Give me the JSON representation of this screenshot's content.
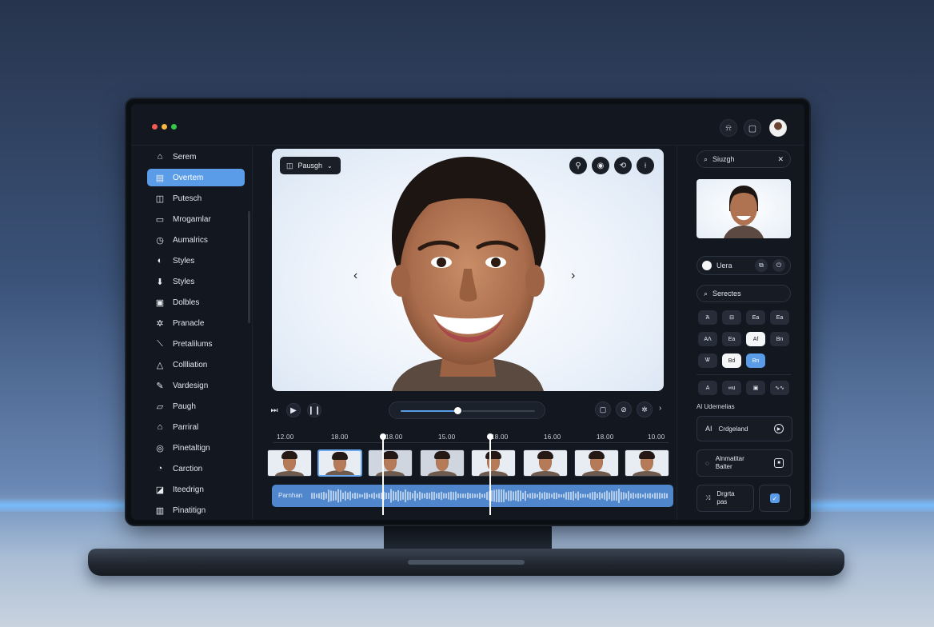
{
  "window": {
    "dots": [
      "#f25a53",
      "#f4b73f",
      "#35c84a"
    ]
  },
  "topbar": {
    "icons": [
      "bell-icon",
      "square-icon"
    ]
  },
  "sidebar": {
    "items": [
      {
        "label": "Serem",
        "icon": "⌂"
      },
      {
        "label": "Overtem",
        "icon": "▤",
        "active": true
      },
      {
        "label": "Putesch",
        "icon": "◫"
      },
      {
        "label": "Mrogamlar",
        "icon": "▭"
      },
      {
        "label": "Aumalrics",
        "icon": "◷"
      },
      {
        "label": "Styles",
        "icon": "◐"
      },
      {
        "label": "Styles",
        "icon": "⬇"
      },
      {
        "label": "Dolbles",
        "icon": "▣"
      },
      {
        "label": "Pranacle",
        "icon": "✲"
      },
      {
        "label": "Pretalilums",
        "icon": "⟍"
      },
      {
        "label": "Collliation",
        "icon": "△"
      },
      {
        "label": "Vardesign",
        "icon": "✎"
      },
      {
        "label": "Paugh",
        "icon": "▱"
      },
      {
        "label": "Parriral",
        "icon": "⌂"
      },
      {
        "label": "Pinetaltign",
        "icon": "◎"
      },
      {
        "label": "Carction",
        "icon": "◔"
      },
      {
        "label": "Iteedrign",
        "icon": "◪"
      },
      {
        "label": "Pinatitign",
        "icon": "▥"
      }
    ]
  },
  "viewer": {
    "preset_label": "Pausgh",
    "tool_icons": [
      "pin-icon",
      "record-icon",
      "rotate-icon",
      "cut-icon"
    ]
  },
  "timeline": {
    "labels": [
      "12.00",
      "18.00",
      "18.00",
      "15.00",
      "18.00",
      "16.00",
      "18.00",
      "10.00"
    ],
    "audio_label": "Parnhan",
    "scrub_fraction": 0.42
  },
  "right_panel": {
    "search": "Siuzgh",
    "toggle_label": "Uera",
    "search2": "Serectes",
    "chips_row1": [
      "Ά",
      "⊟",
      "Ea",
      "Ea"
    ],
    "chips_row2": [
      "AΛ",
      "Ea",
      "Af",
      "Bn"
    ],
    "chips_row3": [
      "Ꮤ",
      "Bd",
      "Bn"
    ],
    "chips_row4": [
      "A",
      "∞u",
      "▣",
      "∿∿"
    ],
    "section_title": "Al Udernelias",
    "card1": "Crdgeland",
    "card2_line1": "Alnmatitar",
    "card2_line2": "Balter",
    "card3_line1": "Drgrta",
    "card3_line2": "pas",
    "accent": "#5b9ce8"
  }
}
